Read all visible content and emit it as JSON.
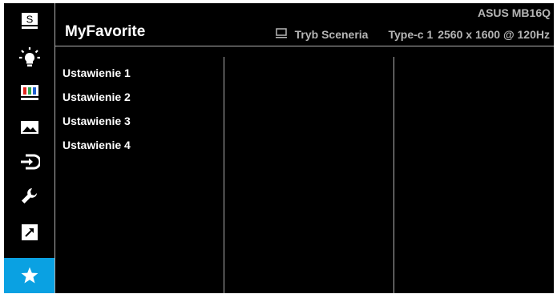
{
  "header": {
    "title": "MyFavorite",
    "model": "ASUS MB16Q",
    "mode_icon": "monitor-icon",
    "mode": "Tryb Sceneria",
    "input": "Type-c 1",
    "resolution": "2560 x 1600 @ 120Hz"
  },
  "sidebar": {
    "items": [
      {
        "icon": "splendid-s-icon",
        "active": false
      },
      {
        "icon": "blue-light-filter-icon",
        "active": false
      },
      {
        "icon": "color-icon",
        "active": false
      },
      {
        "icon": "image-icon",
        "active": false
      },
      {
        "icon": "input-select-icon",
        "active": false
      },
      {
        "icon": "system-setup-icon",
        "active": false
      },
      {
        "icon": "shortcut-icon",
        "active": false
      },
      {
        "icon": "myfavorite-star-icon",
        "active": true
      }
    ],
    "active_color": "#0aa1e2",
    "splendid_letter": "S"
  },
  "menu": {
    "items": [
      "Ustawienie 1",
      "Ustawienie 2",
      "Ustawienie 3",
      "Ustawienie 4"
    ]
  }
}
